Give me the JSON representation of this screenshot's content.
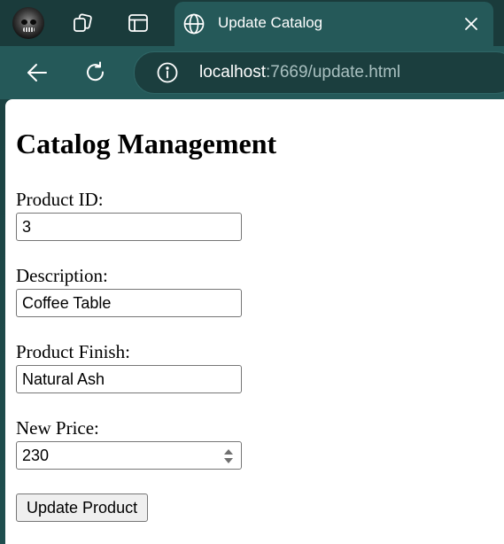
{
  "browser": {
    "tab": {
      "title": "Update Catalog"
    },
    "address_bar": {
      "host": "localhost",
      "rest": ":7669/update.html"
    },
    "colors": {
      "frame": "#1a3b3b",
      "toolbar": "#255959",
      "omnibox": "#1b3e3e"
    }
  },
  "page": {
    "heading": "Catalog Management",
    "fields": {
      "product_id": {
        "label": "Product ID:",
        "value": "3"
      },
      "description": {
        "label": "Description:",
        "value": "Coffee Table"
      },
      "finish": {
        "label": "Product Finish:",
        "value": "Natural Ash"
      },
      "price": {
        "label": "New Price:",
        "value": "230"
      }
    },
    "submit_label": "Update Product"
  }
}
